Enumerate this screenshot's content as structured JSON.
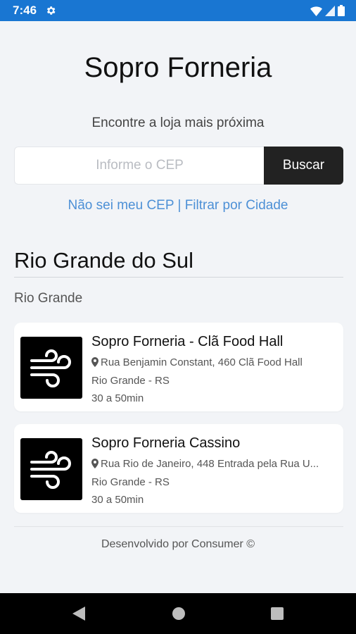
{
  "status_bar": {
    "time": "7:46",
    "settings_icon": "gear-icon"
  },
  "header": {
    "title": "Sopro Forneria",
    "subtitle": "Encontre a loja mais próxima"
  },
  "search": {
    "placeholder": "Informe o CEP",
    "value": "",
    "button_label": "Buscar"
  },
  "links": {
    "no_cep": "Não sei meu CEP",
    "separator": "|",
    "filter_city": "Filtrar por Cidade",
    "color": "#4d90d6"
  },
  "region": {
    "state": "Rio Grande do Sul",
    "city": "Rio Grande"
  },
  "stores": [
    {
      "name": "Sopro Forneria - Clã Food Hall",
      "address": "Rua Benjamin Constant, 460 Clã Food Hall",
      "city": "Rio Grande - RS",
      "delivery_time": "30 a 50min",
      "logo_icon": "wind-icon"
    },
    {
      "name": "Sopro Forneria Cassino",
      "address": "Rua Rio de Janeiro, 448 Entrada pela Rua U...",
      "city": "Rio Grande - RS",
      "delivery_time": "30 a 50min",
      "logo_icon": "wind-icon"
    }
  ],
  "footer": {
    "text": "Desenvolvido por Consumer ©"
  },
  "colors": {
    "status_bar": "#1976d2",
    "search_button": "#222222",
    "link": "#4d90d6",
    "background": "#f2f4f7"
  }
}
